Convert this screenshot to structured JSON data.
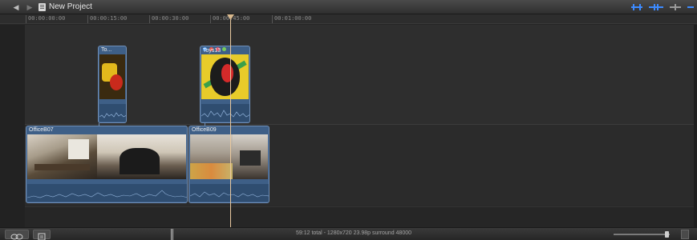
{
  "titlebar": {
    "project_title": "New Project",
    "back_icon": "back-arrow-icon",
    "forward_icon": "forward-arrow-icon"
  },
  "ruler": {
    "timecodes": [
      "00:00:00:00",
      "00:00:15:00",
      "00:00:30:00",
      "00:00:45:00",
      "00:01:00:00"
    ]
  },
  "clips": {
    "connected": [
      {
        "name": "To...",
        "thumb": "toys"
      },
      {
        "name": "Toys13",
        "thumb": "toys-face"
      }
    ],
    "primary": [
      {
        "name": "OfficeB07"
      },
      {
        "name": "OfficeB09"
      }
    ]
  },
  "bottombar": {
    "status": "59:12 total - 1280x720 23.98p surround 48000"
  },
  "colors": {
    "clip_fill": "#3e5f87",
    "clip_border": "#6f8fb8",
    "playhead": "#e9c9a0",
    "tool_blue": "#3d8bff"
  }
}
